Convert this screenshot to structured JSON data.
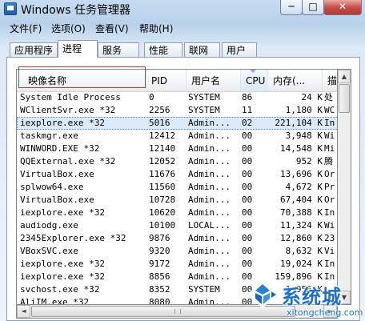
{
  "window": {
    "title": "Windows 任务管理器",
    "min_label": "─",
    "max_label": "□",
    "close_label": "✕"
  },
  "menu": [
    "文件(F)",
    "选项(O)",
    "查看(V)",
    "帮助(H)"
  ],
  "tabs": [
    "应用程序",
    "进程",
    "服务",
    "性能",
    "联网",
    "用户"
  ],
  "active_tab": "进程",
  "columns": {
    "name": "映像名称",
    "pid": "PID",
    "user": "用户名",
    "cpu": "CPU",
    "mem": "内存(...",
    "desc": "描"
  },
  "sorted_column": "cpu",
  "rows": [
    {
      "name": "System Idle Process",
      "pid": "0",
      "user": "SYSTEM",
      "cpu": "86",
      "mem": "24 K",
      "desc": "处"
    },
    {
      "name": "WClientSvr.exe *32",
      "pid": "2256",
      "user": "SYSTEM",
      "cpu": "11",
      "mem": "1,180 K",
      "desc": "WC"
    },
    {
      "name": "iexplore.exe *32",
      "pid": "5016",
      "user": "Admin...",
      "cpu": "02",
      "mem": "221,104 K",
      "desc": "In"
    },
    {
      "name": "taskmgr.exe",
      "pid": "12412",
      "user": "Admin...",
      "cpu": "00",
      "mem": "3,948 K",
      "desc": "Wi"
    },
    {
      "name": "WINWORD.EXE *32",
      "pid": "12140",
      "user": "Admin...",
      "cpu": "00",
      "mem": "14,548 K",
      "desc": "Mi"
    },
    {
      "name": "QQExternal.exe *32",
      "pid": "12052",
      "user": "Admin...",
      "cpu": "00",
      "mem": "952 K",
      "desc": "腾"
    },
    {
      "name": "VirtualBox.exe",
      "pid": "11676",
      "user": "Admin...",
      "cpu": "00",
      "mem": "13,696 K",
      "desc": "Or"
    },
    {
      "name": "splwow64.exe",
      "pid": "11560",
      "user": "Admin...",
      "cpu": "00",
      "mem": "4,672 K",
      "desc": "Pr"
    },
    {
      "name": "VirtualBox.exe",
      "pid": "10728",
      "user": "Admin...",
      "cpu": "00",
      "mem": "67,404 K",
      "desc": "Or"
    },
    {
      "name": "iexplore.exe *32",
      "pid": "10620",
      "user": "Admin...",
      "cpu": "00",
      "mem": "70,388 K",
      "desc": "In"
    },
    {
      "name": "audiodg.exe",
      "pid": "10100",
      "user": "LOCAL...",
      "cpu": "00",
      "mem": "11,324 K",
      "desc": "Wi"
    },
    {
      "name": "2345Explorer.exe *32",
      "pid": "9876",
      "user": "Admin...",
      "cpu": "00",
      "mem": "12,860 K",
      "desc": "23"
    },
    {
      "name": "VBoxSVC.exe",
      "pid": "9320",
      "user": "Admin...",
      "cpu": "00",
      "mem": "8,632 K",
      "desc": "Vi"
    },
    {
      "name": "iexplore.exe *32",
      "pid": "9172",
      "user": "Admin...",
      "cpu": "00",
      "mem": "19,024 K",
      "desc": "In"
    },
    {
      "name": "iexplore.exe *32",
      "pid": "8856",
      "user": "Admin...",
      "cpu": "00",
      "mem": "159,896 K",
      "desc": "In"
    },
    {
      "name": "svchost.exe *32",
      "pid": "8352",
      "user": "SYSTEM",
      "cpu": "00",
      "mem": "1,956 K",
      "desc": ""
    },
    {
      "name": "AliIM.exe *32",
      "pid": "8080",
      "user": "Admin...",
      "cpu": "00",
      "mem": "",
      "desc": ""
    }
  ],
  "selected_row": 2,
  "scroll": {
    "up_icon": "▲",
    "down_icon": "▼",
    "left_icon": "◄",
    "right_icon": "►"
  },
  "watermark": {
    "brand": "系统城",
    "url": "xitongcheng.com"
  },
  "colors": {
    "highlight_border": "#c0392b",
    "selection": "#dbe9f8",
    "brand_blue": "#1f6fc2"
  }
}
